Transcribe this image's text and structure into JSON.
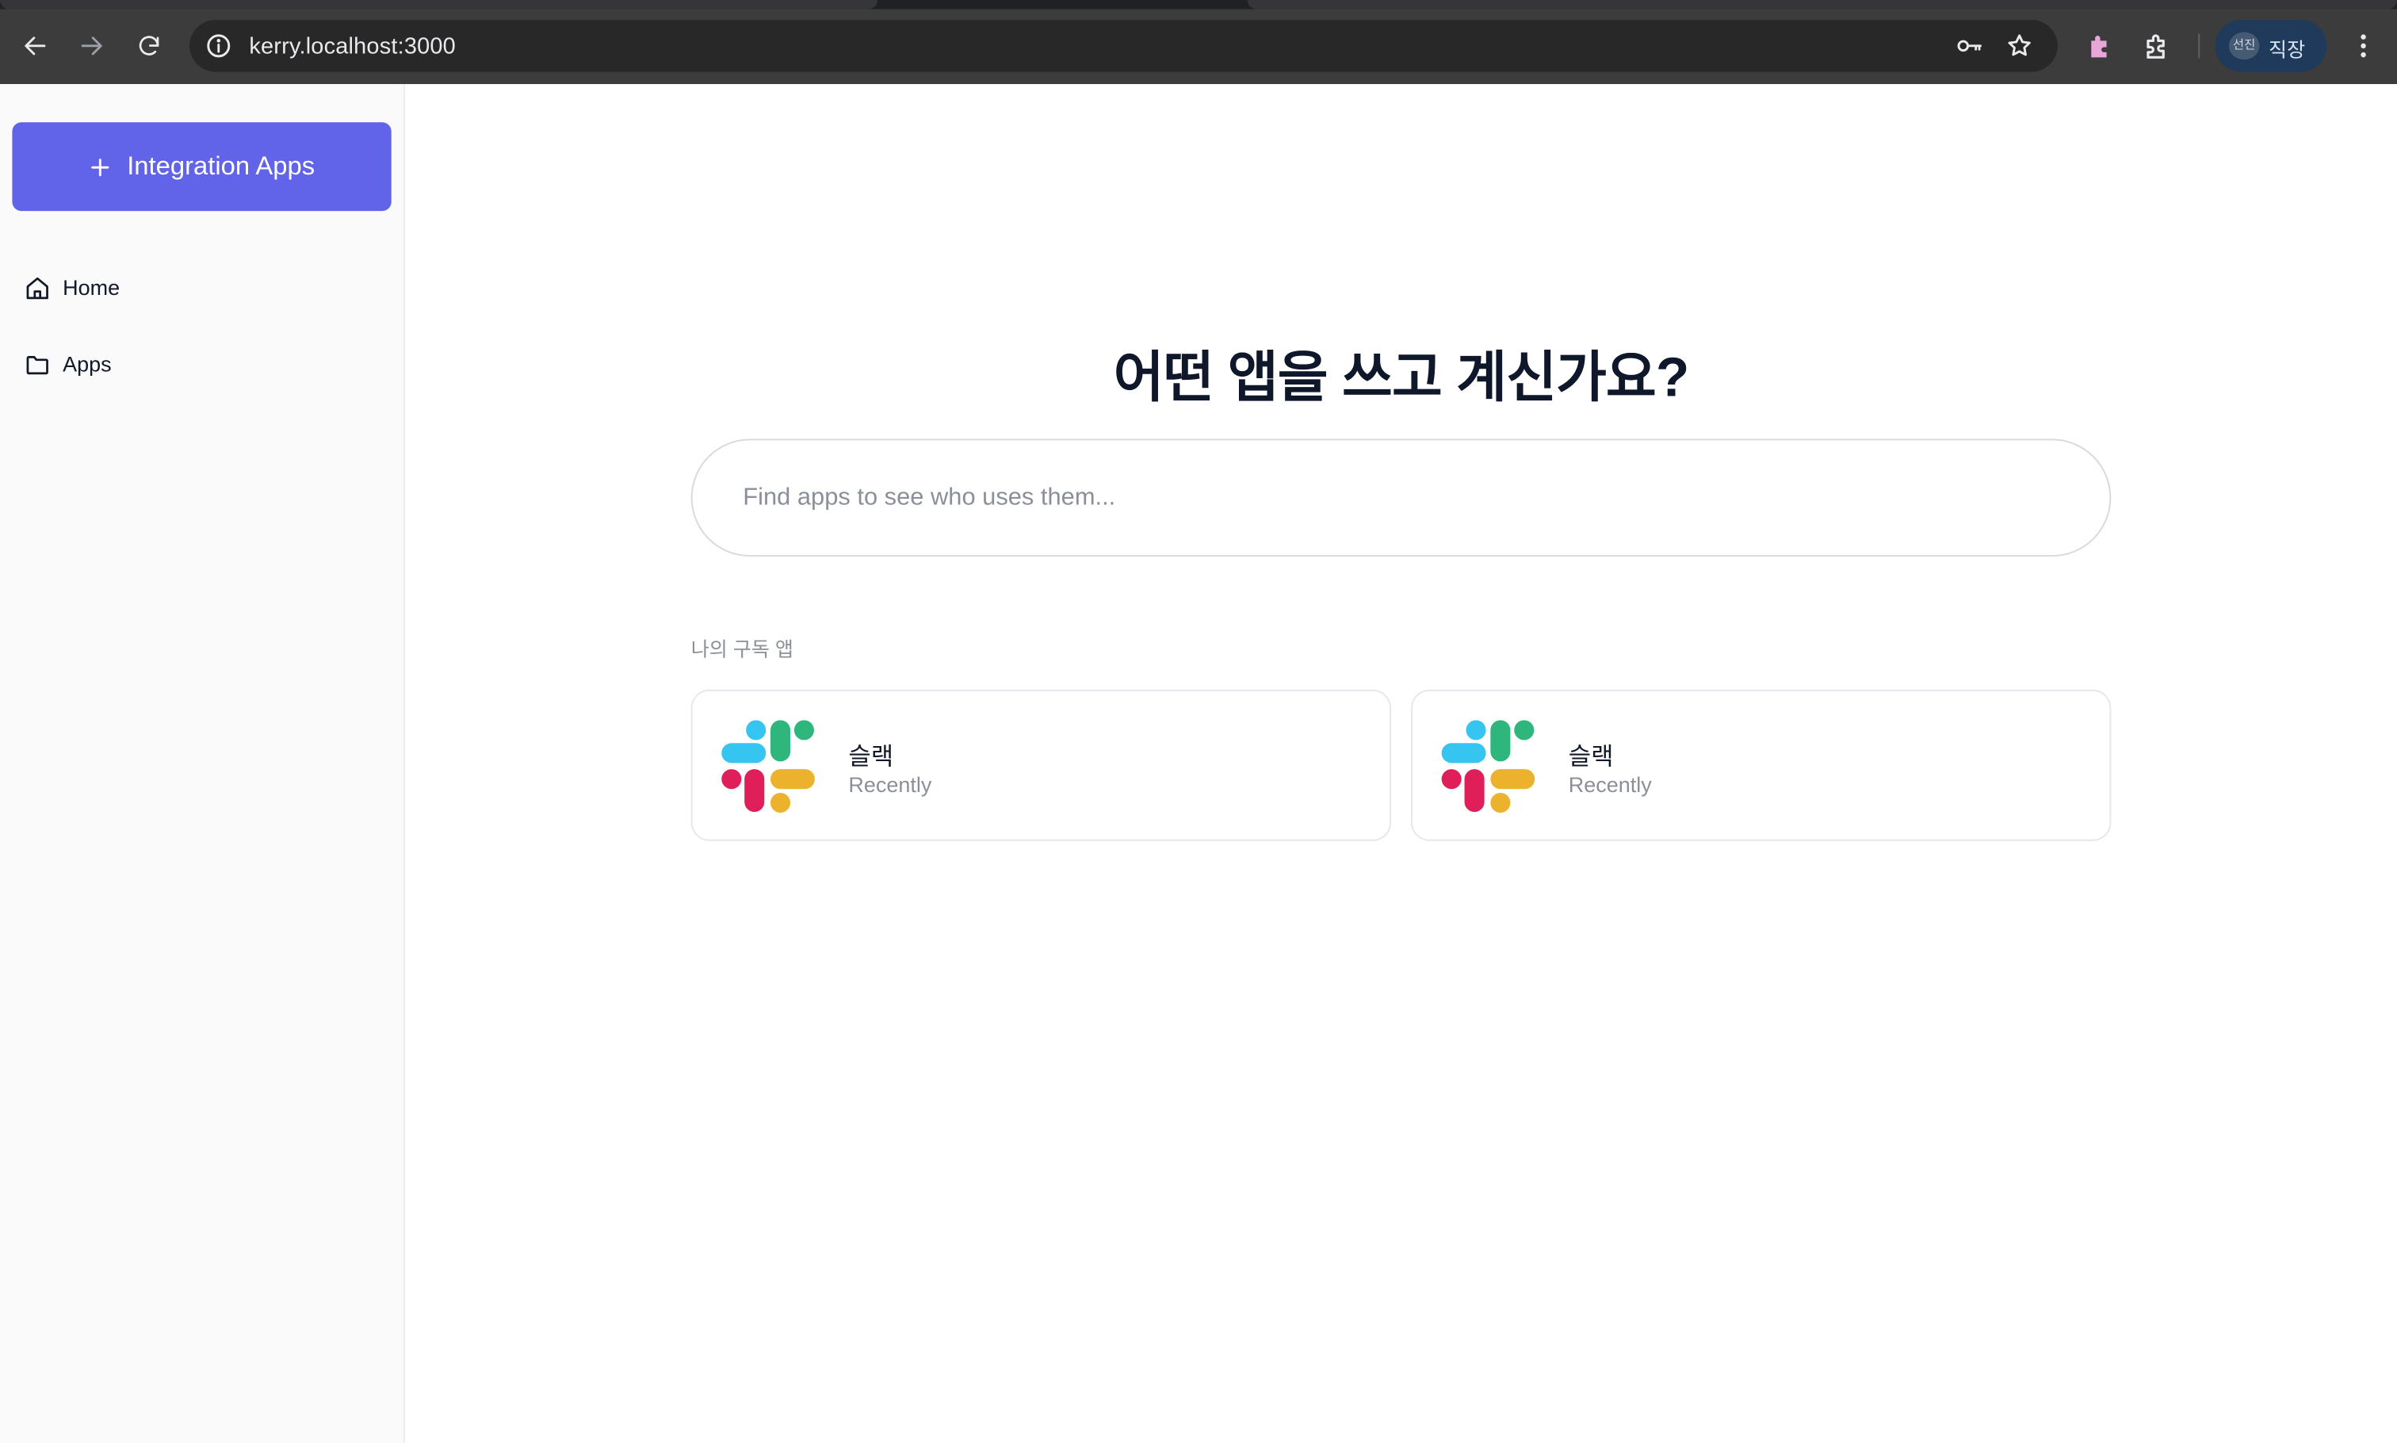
{
  "browser": {
    "url": "kerry.localhost:3000",
    "profile_name": "직장",
    "profile_avatar_text": "선진"
  },
  "sidebar": {
    "add_button_label": "Integration Apps",
    "items": [
      {
        "label": "Home",
        "icon": "home-icon"
      },
      {
        "label": "Apps",
        "icon": "folder-icon"
      }
    ]
  },
  "main": {
    "headline": "어떤 앱을 쓰고 계신가요?",
    "search_placeholder": "Find apps to see who uses them...",
    "section_label": "나의 구독 앱",
    "cards": [
      {
        "name": "슬랙",
        "status": "Recently",
        "icon": "slack-logo-icon"
      },
      {
        "name": "슬랙",
        "status": "Recently",
        "icon": "slack-logo-icon"
      }
    ]
  },
  "colors": {
    "accent": "#6163e8",
    "chrome": "#3c3c3c",
    "slack_blue": "#36c5f0",
    "slack_green": "#2eb67d",
    "slack_yellow": "#ecb22e",
    "slack_red": "#e01e5a"
  }
}
